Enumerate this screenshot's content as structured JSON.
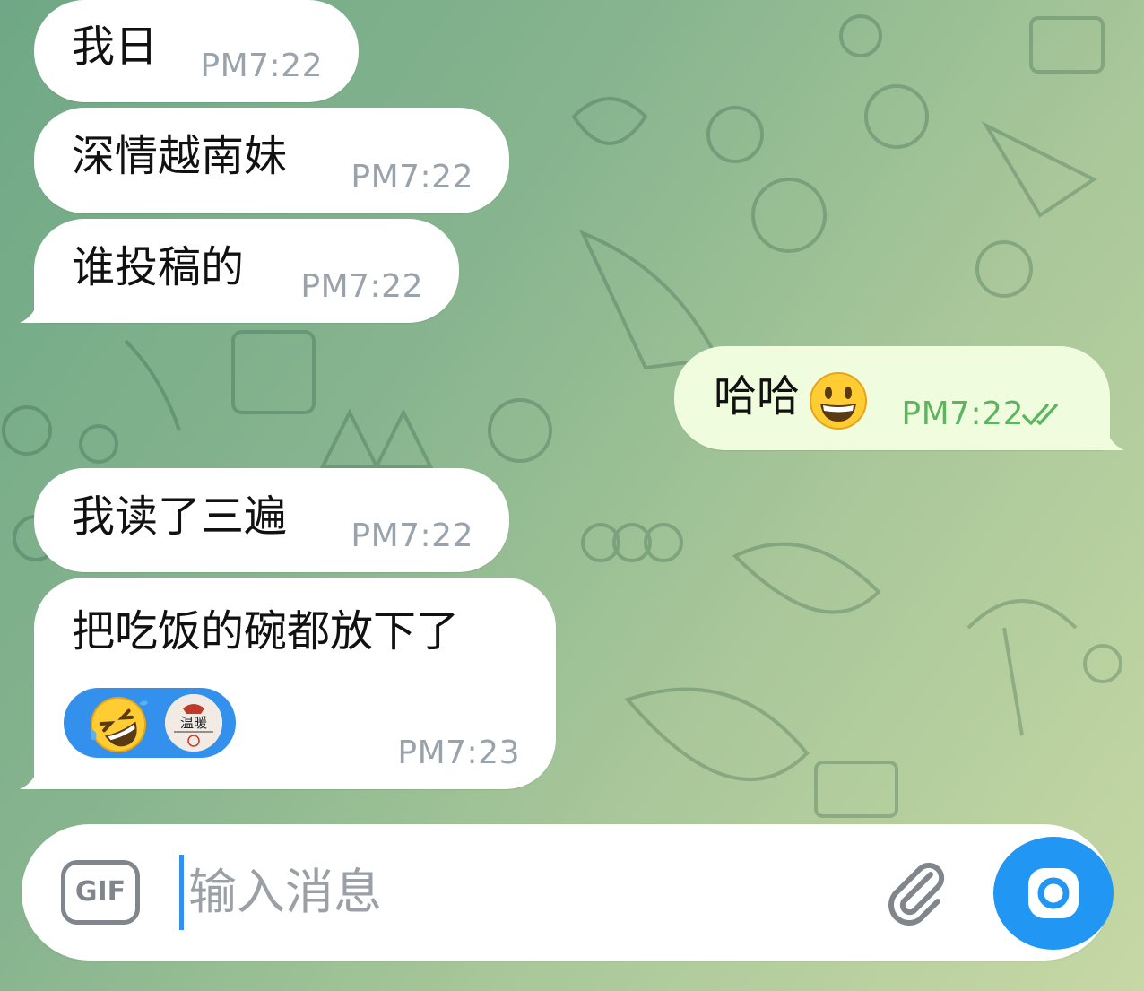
{
  "messages": [
    {
      "text": "我日",
      "time": "PM7:22",
      "direction": "incoming"
    },
    {
      "text": "深情越南妹",
      "time": "PM7:22",
      "direction": "incoming"
    },
    {
      "text": "谁投稿的",
      "time": "PM7:22",
      "direction": "incoming"
    },
    {
      "text": "哈哈",
      "emoji": "grinning-face",
      "time": "PM7:22",
      "direction": "outgoing",
      "status": "read"
    },
    {
      "text": "我读了三遍",
      "time": "PM7:22",
      "direction": "incoming"
    },
    {
      "text": "把吃饭的碗都放下了",
      "time": "PM7:23",
      "direction": "incoming",
      "reaction": {
        "emoji": "rolling-on-the-floor-laughing",
        "avatar": "user-avatar"
      }
    }
  ],
  "composer": {
    "gif_label": "GIF",
    "placeholder": "输入消息",
    "attach_icon": "paperclip-icon",
    "send_icon": "camera-icon"
  },
  "colors": {
    "incoming_bubble": "#ffffff",
    "outgoing_bubble": "#effdde",
    "outgoing_time": "#5fb462",
    "time": "#9aa3ab",
    "accent": "#2196f3",
    "reaction_pill": "#3390ec"
  }
}
